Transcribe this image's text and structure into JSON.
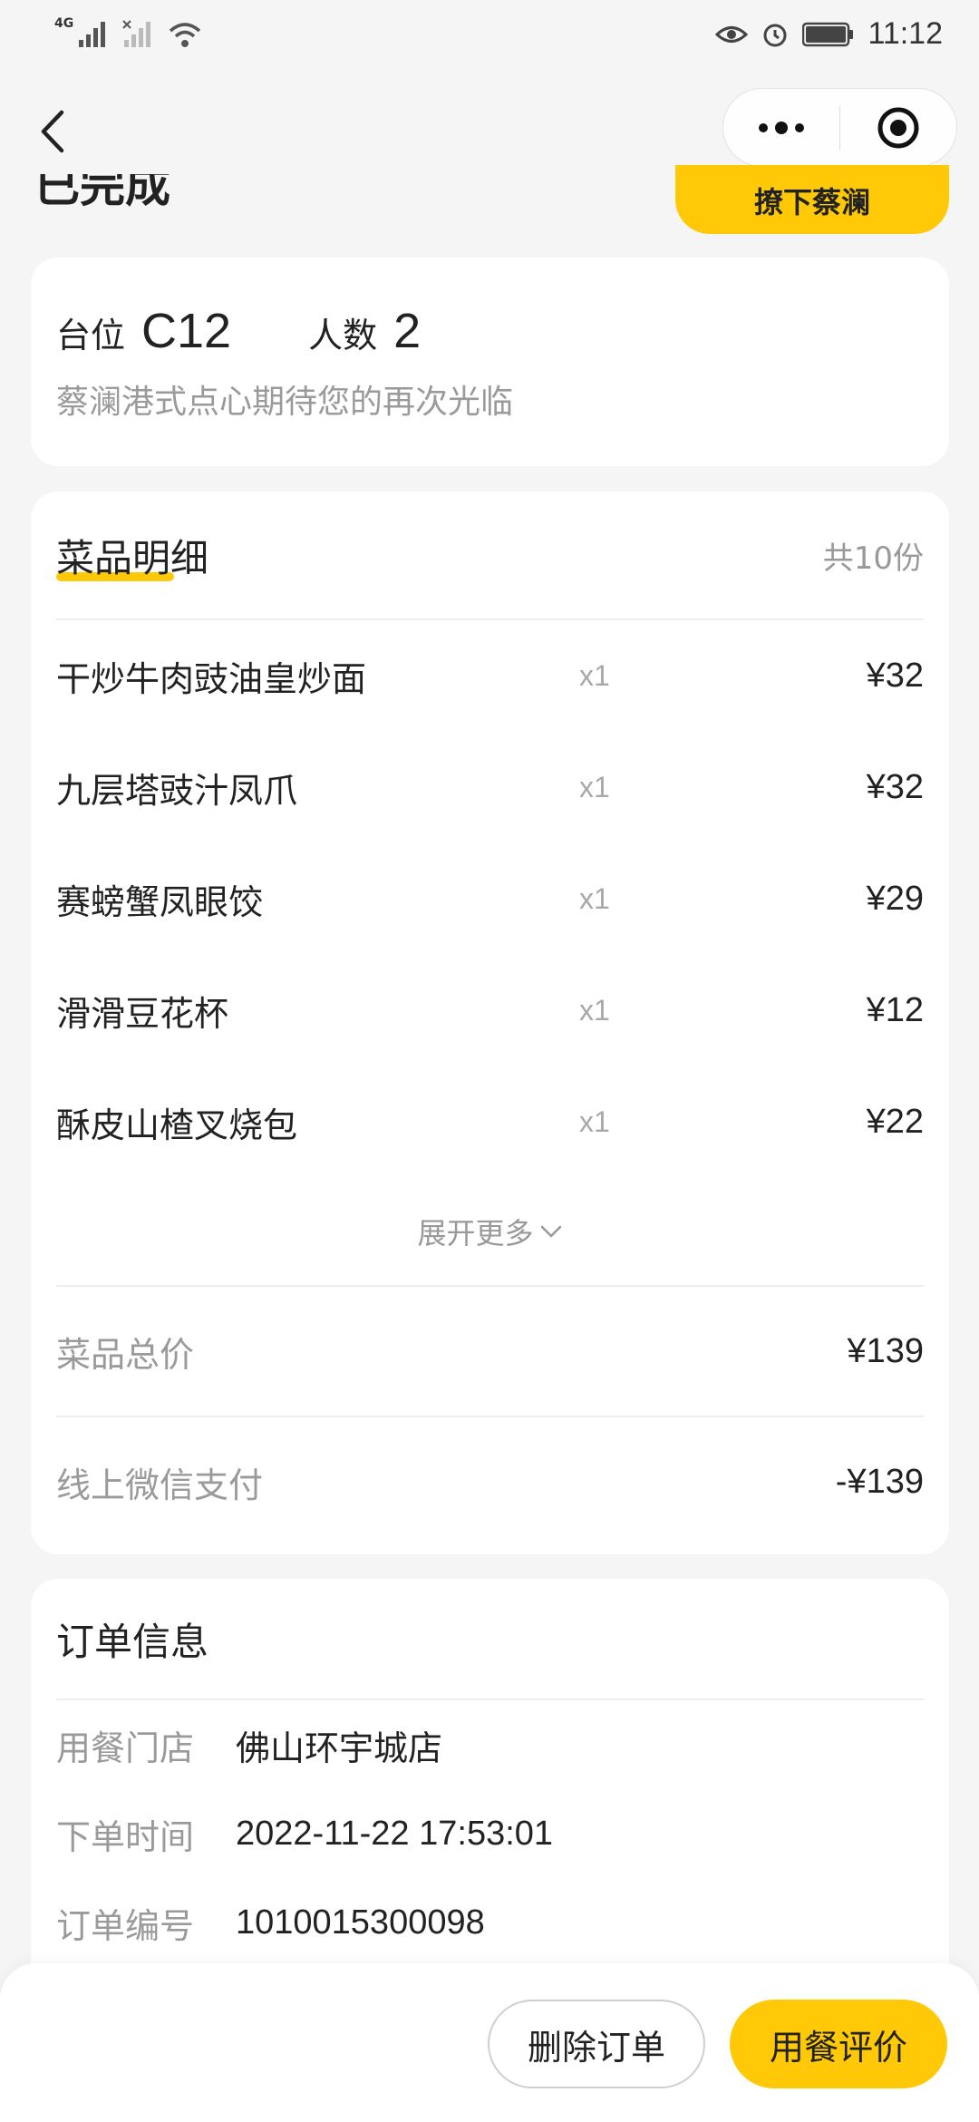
{
  "status_bar": {
    "network": "4G",
    "time": "11:12",
    "icons": [
      "signal-icon",
      "signal-x-icon",
      "wifi-icon",
      "eye-icon",
      "alarm-icon",
      "battery-icon"
    ]
  },
  "navbar": {
    "back_icon": "chevron-left-icon",
    "more_icon": "more-dots-icon",
    "close_icon": "target-circle-icon"
  },
  "status_header": {
    "title": "已完成",
    "button_label": "撩下蔡澜"
  },
  "table_info": {
    "table_label": "台位",
    "table_value": "C12",
    "people_label": "人数",
    "people_value": "2",
    "subtitle": "蔡澜港式点心期待您的再次光临"
  },
  "dishes": {
    "title": "菜品明细",
    "count": "共10份",
    "items": [
      {
        "name": "干炒牛肉豉油皇炒面",
        "qty": "x1",
        "price": "¥32"
      },
      {
        "name": "九层塔豉汁凤爪",
        "qty": "x1",
        "price": "¥32"
      },
      {
        "name": "赛螃蟹凤眼饺",
        "qty": "x1",
        "price": "¥29"
      },
      {
        "name": "滑滑豆花杯",
        "qty": "x1",
        "price": "¥12"
      },
      {
        "name": "酥皮山楂叉烧包",
        "qty": "x1",
        "price": "¥22"
      }
    ],
    "expand_label": "展开更多",
    "total_label": "菜品总价",
    "total_value": "¥139",
    "payment_label": "线上微信支付",
    "payment_value": "-¥139"
  },
  "order_info": {
    "title": "订单信息",
    "rows": [
      {
        "label": "用餐门店",
        "value": "佛山环宇城店"
      },
      {
        "label": "下单时间",
        "value": "2022-11-22 17:53:01"
      },
      {
        "label": "订单编号",
        "value": "1010015300098"
      }
    ]
  },
  "bottom_bar": {
    "delete_label": "删除订单",
    "review_label": "用餐评价"
  },
  "colors": {
    "accent": "#ffc907",
    "background": "#f5f5f5",
    "muted_text": "#9a9a9a"
  }
}
